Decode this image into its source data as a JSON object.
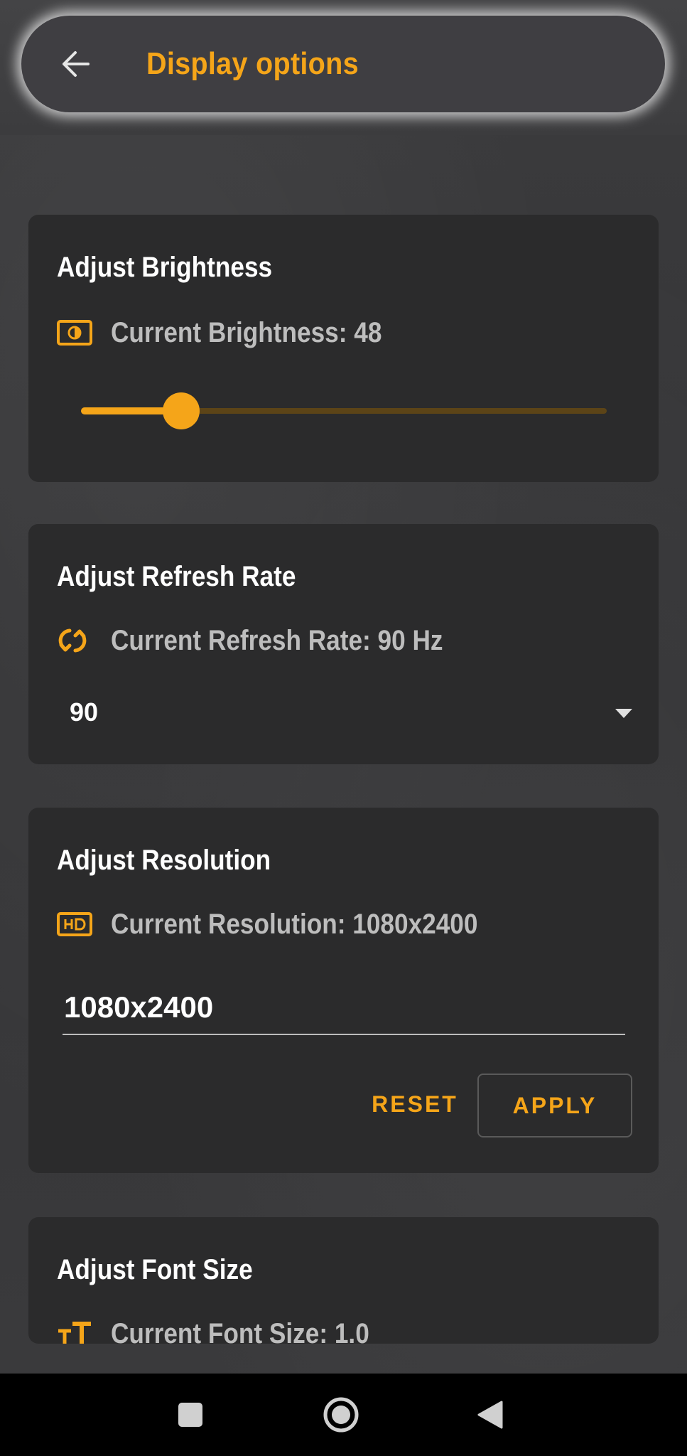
{
  "header": {
    "title": "Display options",
    "back_icon": "arrow-left-icon"
  },
  "colors": {
    "accent": "#f5a519",
    "card": "#2b2b2c",
    "text": "#ffffff",
    "muted": "#bdbdbd"
  },
  "brightness": {
    "title": "Adjust Brightness",
    "icon": "brightness-icon",
    "current_label": "Current Brightness: 48",
    "slider_fraction": 0.19
  },
  "refresh_rate": {
    "title": "Adjust Refresh Rate",
    "icon": "refresh-icon",
    "current_label": "Current Refresh Rate: 90 Hz",
    "selected": "90"
  },
  "resolution": {
    "title": "Adjust Resolution",
    "icon": "hd-icon",
    "current_label": "Current Resolution: 1080x2400",
    "input_value": "1080x2400",
    "reset_label": "RESET",
    "apply_label": "APPLY"
  },
  "font_size": {
    "title": "Adjust Font Size",
    "icon": "text-size-icon",
    "current_label": "Current Font Size: 1.0"
  },
  "nav": {
    "recents": "square-icon",
    "home": "circle-home-icon",
    "back": "triangle-back-icon"
  }
}
